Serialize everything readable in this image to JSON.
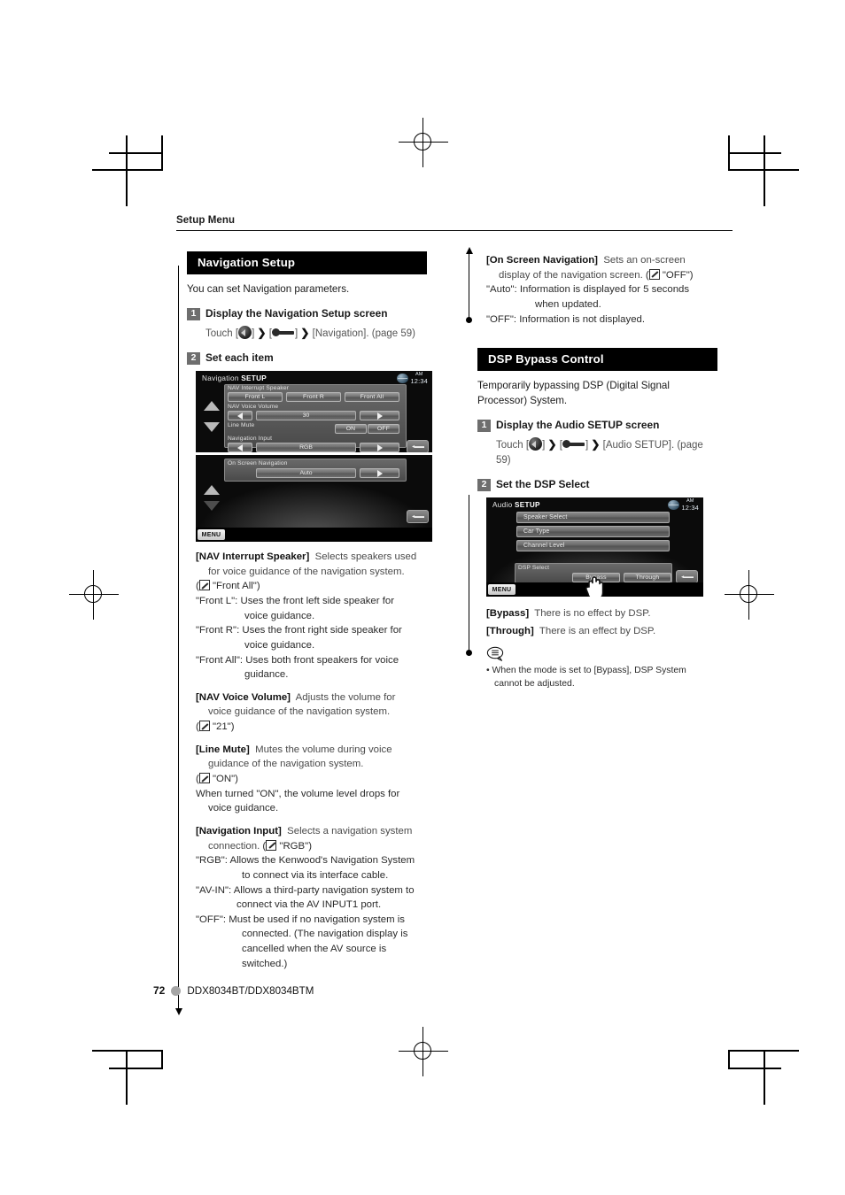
{
  "running_head": "Setup Menu",
  "footer": {
    "page_number": "72",
    "model": "DDX8034BT/DDX8034BTM"
  },
  "left_column": {
    "section": {
      "banner": "Navigation Setup",
      "intro": "You can set Navigation parameters.",
      "steps": [
        {
          "num": "1",
          "title": "Display the Navigation Setup screen",
          "touch_prefix": "Touch [",
          "touch_mid": "] ",
          "touch_target": "[Navigation]. (page 59)"
        },
        {
          "num": "2",
          "title": "Set each item"
        }
      ]
    },
    "screens": [
      {
        "title_light": "Navigation ",
        "title_bold": "SETUP",
        "clock_am": "AM",
        "clock_time": "12:34",
        "groups": [
          {
            "label": "NAV Interrupt Speaker",
            "buttons": [
              "Front L",
              "Front R",
              "Front All"
            ]
          },
          {
            "label": "NAV Voice Volume",
            "value": "30"
          },
          {
            "label": "Line Mute",
            "buttons": [
              "ON",
              "OFF"
            ]
          },
          {
            "label": "Navigation Input",
            "value": "RGB"
          }
        ]
      },
      {
        "groups": [
          {
            "label": "On Screen Navigation",
            "value": "Auto"
          }
        ],
        "menu_label": "MENU"
      }
    ],
    "items": [
      {
        "key": "[NAV Interrupt Speaker]",
        "desc": "Selects speakers used for voice guidance of the navigation system.",
        "default": "\"Front All\"",
        "options": [
          {
            "name": "\"Front L\":",
            "text": "Uses the front left side speaker for voice guidance."
          },
          {
            "name": "\"Front R\":",
            "text": "Uses the front right side speaker for voice guidance."
          },
          {
            "name": "\"Front All\":",
            "text": "Uses both front speakers for voice guidance."
          }
        ]
      },
      {
        "key": "[NAV Voice Volume]",
        "desc": "Adjusts the volume for voice guidance of the navigation system.",
        "default": "\"21\"",
        "options": []
      },
      {
        "key": "[Line Mute]",
        "desc": "Mutes the volume during voice guidance of the navigation system.",
        "default": "\"ON\"",
        "extra": "When turned \"ON\", the volume level drops for voice guidance.",
        "options": []
      },
      {
        "key": "[Navigation Input]",
        "desc": "Selects a navigation system connection.",
        "default": "\"RGB\"",
        "inline_default": true,
        "options": [
          {
            "name": "\"RGB\":",
            "text": "Allows the Kenwood's Navigation System to connect via its interface cable."
          },
          {
            "name": "\"AV-IN\":",
            "text": "Allows a third-party navigation system to connect via the AV INPUT1 port."
          },
          {
            "name": "\"OFF\":",
            "text": "Must be used if no navigation system is connected. (The navigation display is cancelled when the AV source is switched.)"
          }
        ]
      }
    ]
  },
  "right_column": {
    "continued_item": {
      "key": "[On Screen Navigation]",
      "desc": "Sets an on-screen display of the navigation screen.",
      "default": "\"OFF\"",
      "options": [
        {
          "name": "\"Auto\":",
          "text": "Information is displayed for 5 seconds when updated."
        },
        {
          "name": "\"OFF\":",
          "text": "Information is not displayed."
        }
      ]
    },
    "section": {
      "banner": "DSP Bypass Control",
      "intro": "Temporarily bypassing DSP (Digital Signal Processor) System.",
      "steps": [
        {
          "num": "1",
          "title": "Display the Audio SETUP screen",
          "touch_prefix": "Touch [",
          "touch_mid": "] ",
          "touch_target": "[Audio SETUP]. (page 59)"
        },
        {
          "num": "2",
          "title": "Set the DSP Select"
        }
      ]
    },
    "screen": {
      "title_light": "Audio ",
      "title_bold": "SETUP",
      "clock_am": "AM",
      "clock_time": "12:34",
      "list_items": [
        "Speaker Select",
        "Car Type",
        "Channel Level"
      ],
      "dsp_label": "DSP Select",
      "dsp_buttons": [
        "Bypass",
        "Through"
      ],
      "menu_label": "MENU"
    },
    "items": [
      {
        "key": "[Bypass]",
        "desc": "There is no effect by DSP."
      },
      {
        "key": "[Through]",
        "desc": "There is an effect by DSP."
      }
    ],
    "note": "When the mode is set to [Bypass], DSP System cannot be adjusted."
  }
}
